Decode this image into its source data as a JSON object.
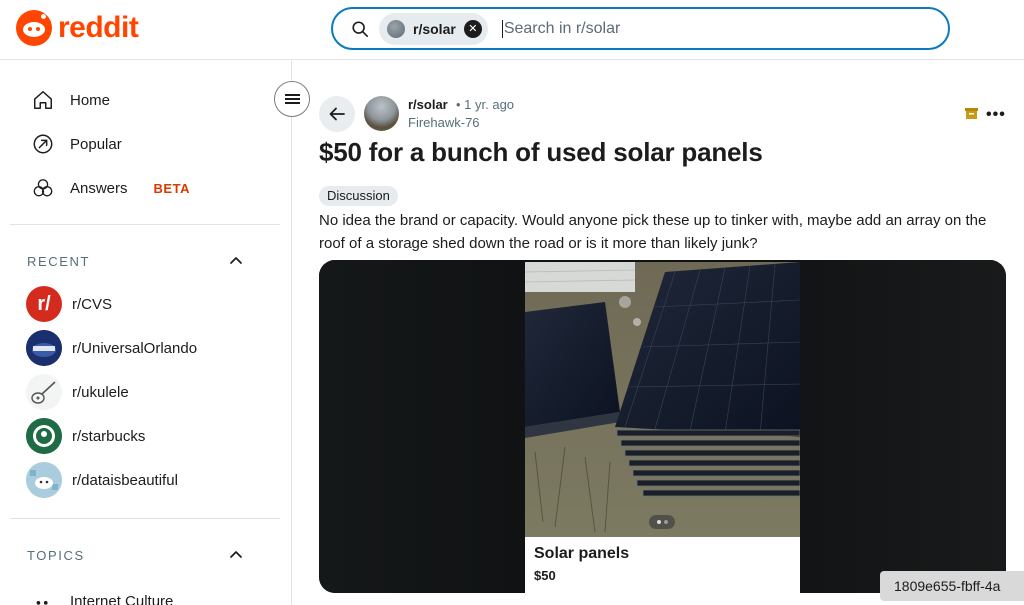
{
  "header": {
    "logo_text": "reddit",
    "search": {
      "chip_label": "r/solar",
      "placeholder": "Search in r/solar"
    }
  },
  "sidebar": {
    "nav": [
      {
        "label": "Home",
        "icon": "home-icon"
      },
      {
        "label": "Popular",
        "icon": "popular-icon"
      },
      {
        "label": "Answers",
        "icon": "answers-icon",
        "badge": "BETA"
      }
    ],
    "recent_label": "RECENT",
    "recent": [
      {
        "label": "r/CVS",
        "icon": "cvs-icon"
      },
      {
        "label": "r/UniversalOrlando",
        "icon": "universal-icon"
      },
      {
        "label": "r/ukulele",
        "icon": "ukulele-icon"
      },
      {
        "label": "r/starbucks",
        "icon": "starbucks-icon"
      },
      {
        "label": "r/dataisbeautiful",
        "icon": "dataisbeautiful-icon"
      }
    ],
    "topics_label": "TOPICS",
    "topics": [
      {
        "label": "Internet Culture"
      }
    ]
  },
  "post": {
    "subreddit": "r/solar",
    "time": "• 1 yr. ago",
    "author": "Firehawk-76",
    "title": "$50 for a bunch of used solar panels",
    "flair": "Discussion",
    "body": "No idea the brand or capacity. Would anyone pick these up to tinker with, maybe add an array on the roof of a storage shed down the road or is it more than likely junk?",
    "media": {
      "caption_title": "Solar panels",
      "caption_price": "$50"
    }
  },
  "overlay_id": "1809e655-fbff-4a",
  "colors": {
    "brand": "#ff4500",
    "search_border": "#0a7bbf",
    "beta": "#d93a00"
  }
}
